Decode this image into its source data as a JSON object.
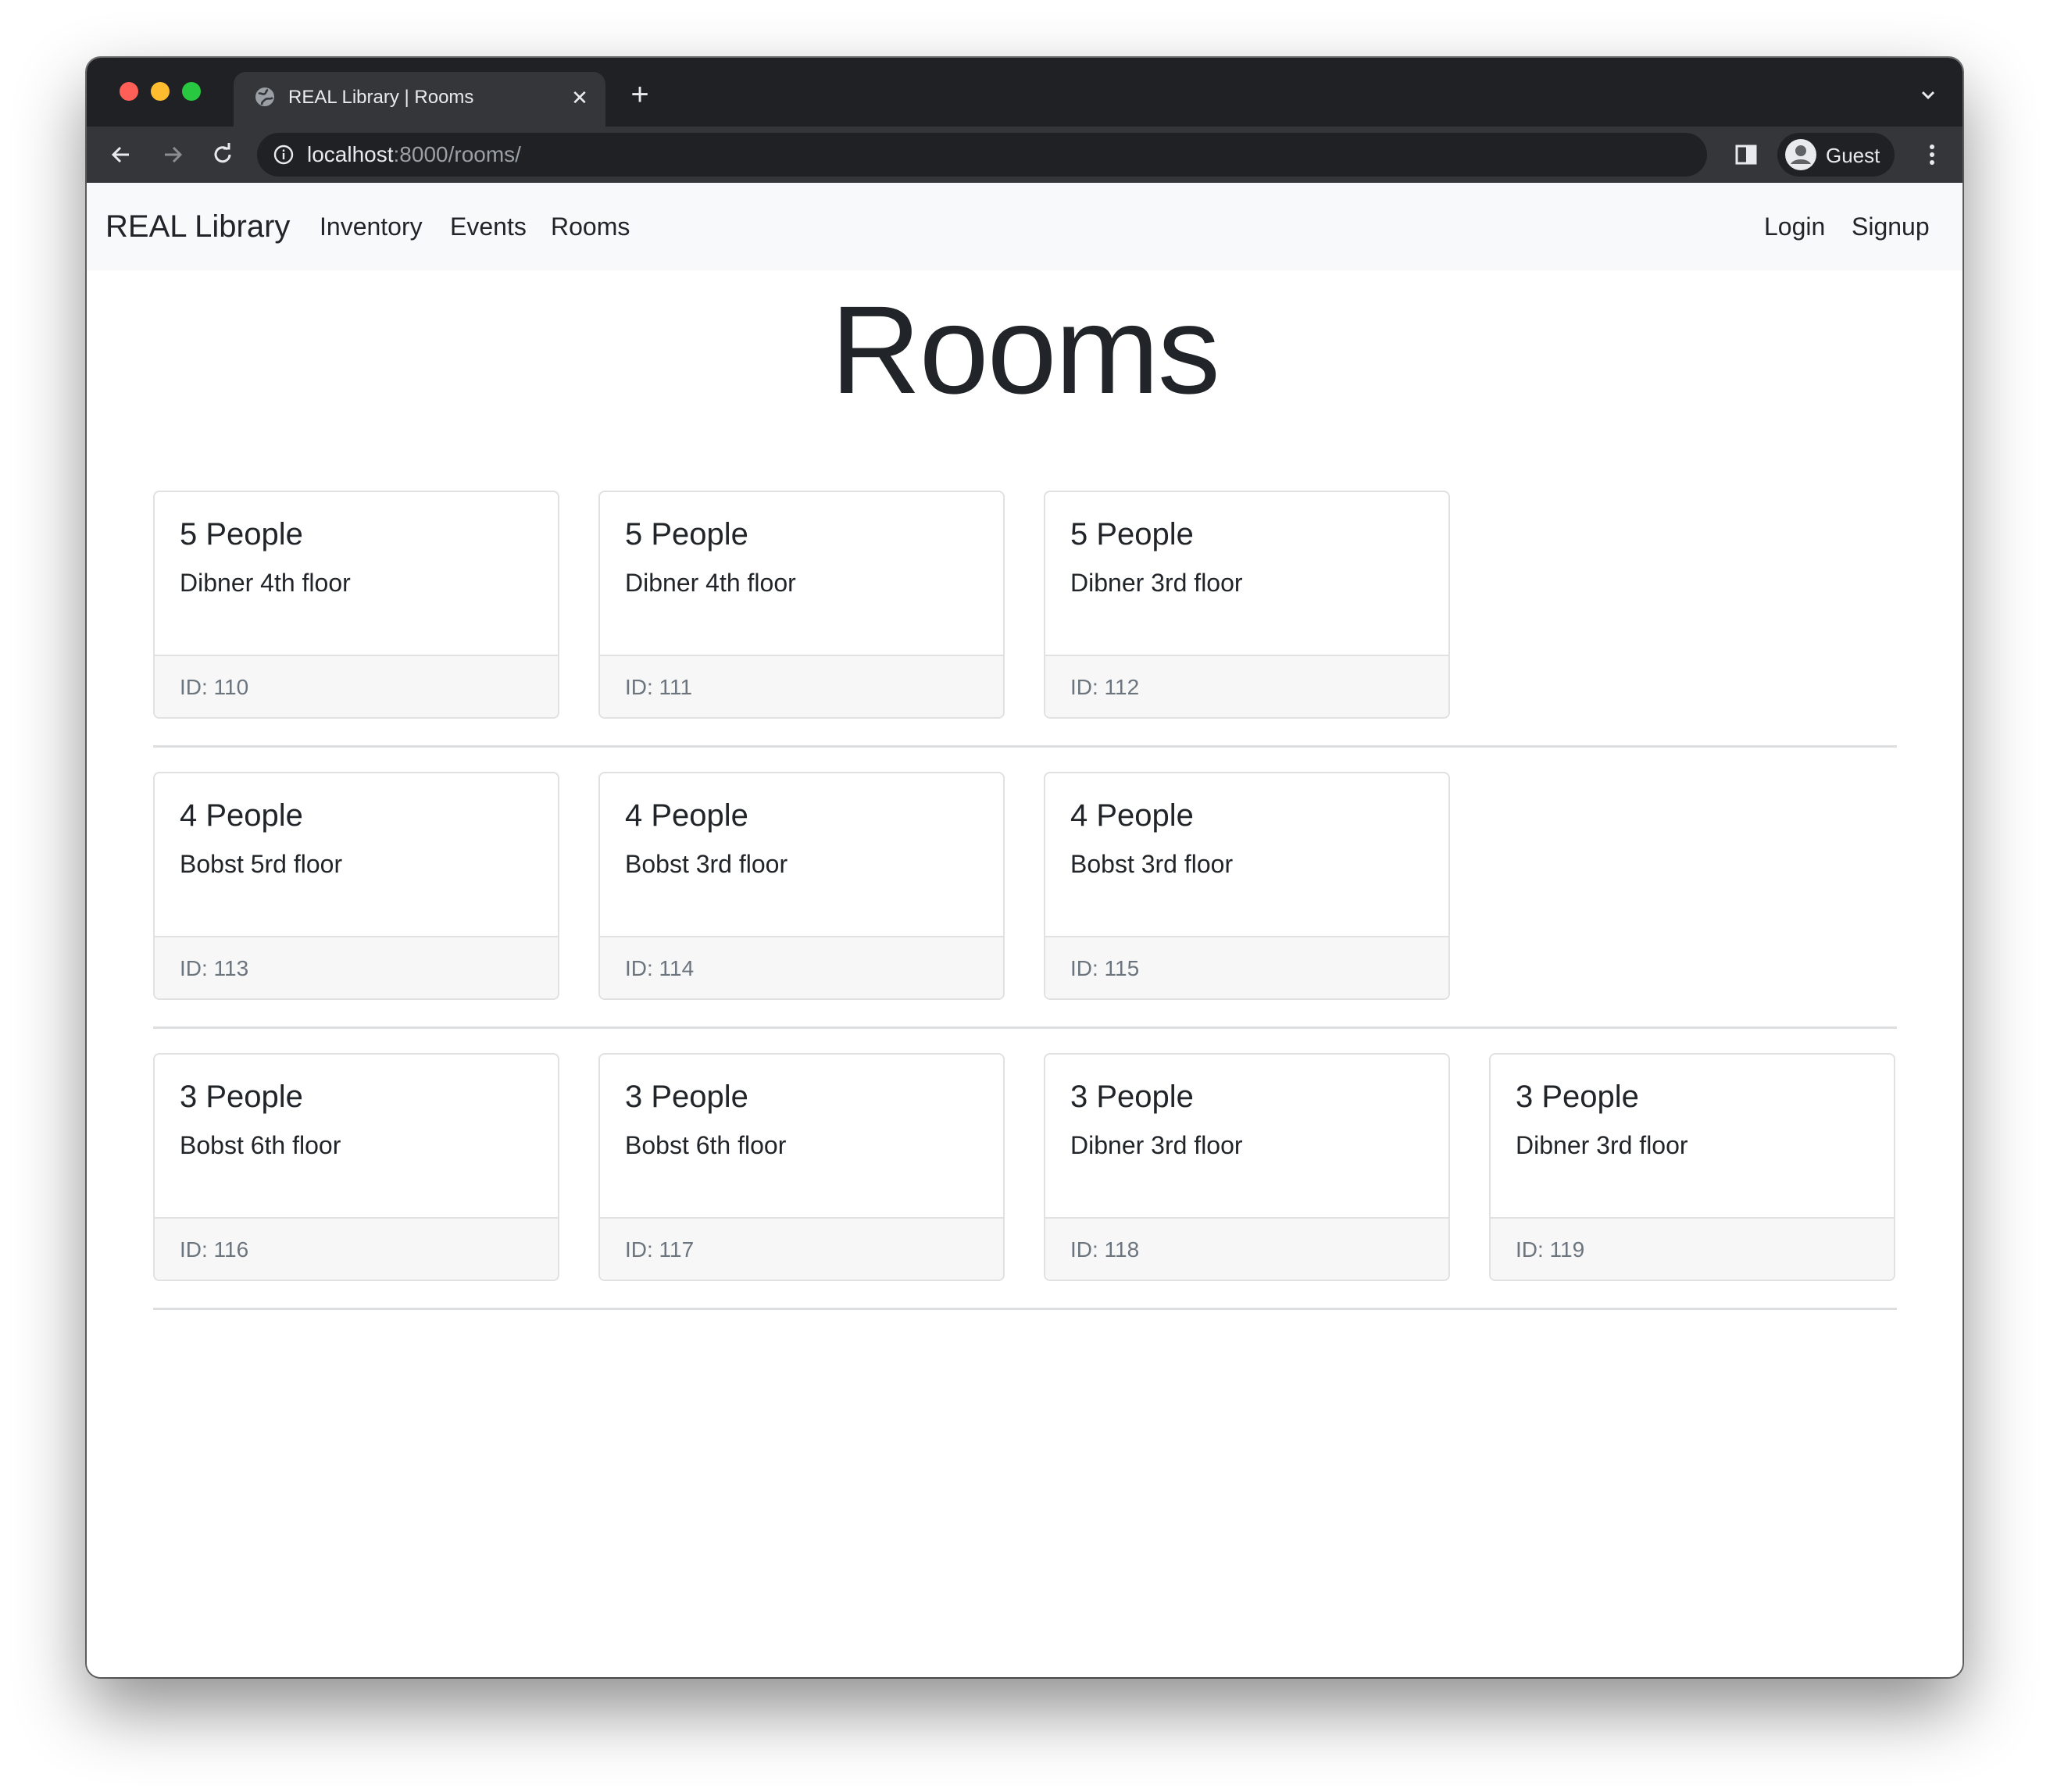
{
  "browser": {
    "tab_title": "REAL Library | Rooms",
    "url_host": "localhost",
    "url_rest": ":8000/rooms/",
    "profile_name": "Guest",
    "icons": [
      "globe-icon",
      "close-icon",
      "plus-icon",
      "chevron-down-icon",
      "back-arrow-icon",
      "forward-arrow-icon",
      "reload-icon",
      "info-icon",
      "side-panel-icon",
      "avatar-icon",
      "more-vertical-icon"
    ]
  },
  "navbar": {
    "brand": "REAL Library",
    "links": [
      "Inventory",
      "Events",
      "Rooms"
    ],
    "login": "Login",
    "signup": "Signup"
  },
  "page": {
    "title": "Rooms"
  },
  "rows": [
    {
      "cards": [
        {
          "capacity": "5 People",
          "location": "Dibner 4th floor",
          "id": "ID: 110"
        },
        {
          "capacity": "5 People",
          "location": "Dibner 4th floor",
          "id": "ID: 111"
        },
        {
          "capacity": "5 People",
          "location": "Dibner 3rd floor",
          "id": "ID: 112"
        }
      ]
    },
    {
      "cards": [
        {
          "capacity": "4 People",
          "location": "Bobst 5rd floor",
          "id": "ID: 113"
        },
        {
          "capacity": "4 People",
          "location": "Bobst 3rd floor",
          "id": "ID: 114"
        },
        {
          "capacity": "4 People",
          "location": "Bobst 3rd floor",
          "id": "ID: 115"
        }
      ]
    },
    {
      "cards": [
        {
          "capacity": "3 People",
          "location": "Bobst 6th floor",
          "id": "ID: 116"
        },
        {
          "capacity": "3 People",
          "location": "Bobst 6th floor",
          "id": "ID: 117"
        },
        {
          "capacity": "3 People",
          "location": "Dibner 3rd floor",
          "id": "ID: 118"
        },
        {
          "capacity": "3 People",
          "location": "Dibner 3rd floor",
          "id": "ID: 119"
        }
      ]
    }
  ]
}
